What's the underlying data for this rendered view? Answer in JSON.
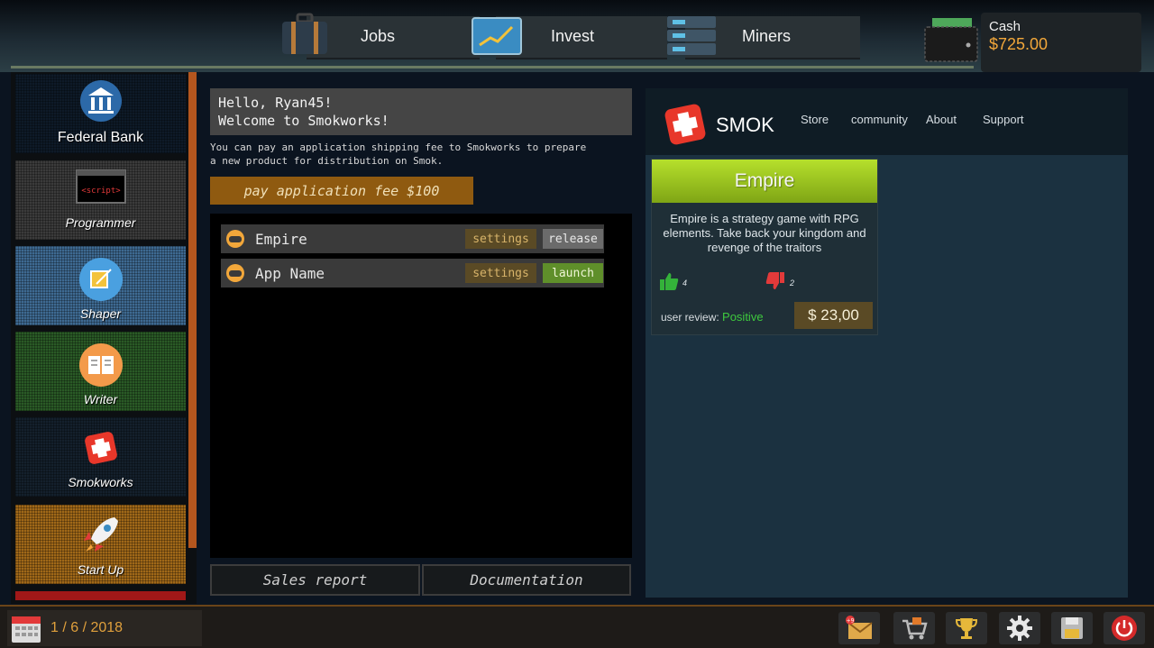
{
  "nav": {
    "jobs": "Jobs",
    "invest": "Invest",
    "miners": "Miners"
  },
  "cash": {
    "label": "Cash",
    "amount": "$725.00"
  },
  "sidebar": {
    "items": [
      {
        "label": "Federal Bank",
        "icon": "bank-icon"
      },
      {
        "label": "Programmer",
        "icon": "script-monitor-icon",
        "icon_text": "<script>"
      },
      {
        "label": "Shaper",
        "icon": "shaper-icon"
      },
      {
        "label": "Writer",
        "icon": "book-icon"
      },
      {
        "label": "Smokworks",
        "icon": "smok-icon"
      },
      {
        "label": "Start Up",
        "icon": "rocket-icon"
      }
    ]
  },
  "greeting": {
    "line1": "Hello, Ryan45!",
    "line2": "Welcome to Smokworks!"
  },
  "info": {
    "line1": "You can pay an application shipping fee to Smokworks to prepare",
    "line2": "a new product for distribution on Smok."
  },
  "fee_button": "pay application fee $100",
  "apps": [
    {
      "name": "Empire",
      "settings": "settings",
      "action": "release"
    },
    {
      "name": "App Name",
      "settings": "settings",
      "action": "launch"
    }
  ],
  "tabs": {
    "sales": "Sales report",
    "docs": "Documentation"
  },
  "store": {
    "brand": "SMOK",
    "links": [
      "Store",
      "community",
      "About",
      "Support"
    ],
    "product": {
      "title": "Empire",
      "description": "Empire is a strategy game with RPG elements. Take back your kingdom and revenge of the traitors",
      "likes": "4",
      "dislikes": "2",
      "review_label": "user review:",
      "review_value": "Positive",
      "price": "$ 23,00"
    }
  },
  "date": "1 / 6 / 2018",
  "tray_badge": "+9",
  "colors": {
    "accent_orange": "#f2a73a",
    "launch_green": "#5f8f2a",
    "positive_green": "#3ec93e",
    "card_title_green": "#9cc620"
  }
}
